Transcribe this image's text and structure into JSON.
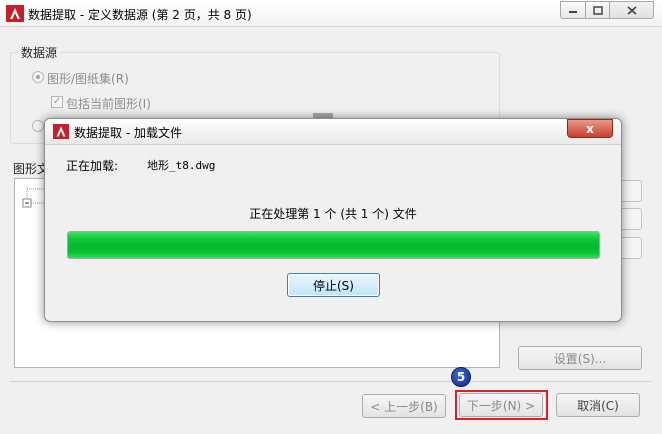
{
  "main_window": {
    "title": "数据提取 - 定义数据源 (第 2 页，共 8 页)",
    "source_group": {
      "legend": "数据源",
      "option_drawings": "图形/图纸集(R)",
      "option_include_current": "包括当前图形(I)"
    },
    "tree_label": "图形文",
    "buttons": {
      "settings": "设置(S)...",
      "back": "< 上一步(B)",
      "next": "下一步(N) >",
      "cancel": "取消(C)"
    },
    "step_badge": "5"
  },
  "loading_dialog": {
    "title": "数据提取 - 加载文件",
    "loading_label": "正在加载:",
    "loading_file": "地形_t8.dwg",
    "status": "正在处理第 1 个 (共 1 个) 文件",
    "progress_fraction": 1.0,
    "stop_button": "停止(S)",
    "close_glyph": "x"
  },
  "colors": {
    "progress": "#10c93a",
    "highlight": "#e02020",
    "badge": "#1a3fa8",
    "logo_red": "#c8202a"
  },
  "icons": {
    "app_logo": "autocad-logo-icon",
    "minimize": "minimize-icon",
    "maximize": "maximize-icon",
    "close": "close-icon"
  }
}
